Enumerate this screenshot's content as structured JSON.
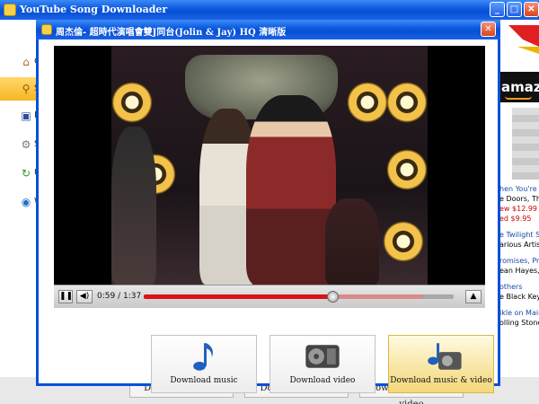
{
  "main_window": {
    "title": "YouTube Song Downloader",
    "sidebar_items": [
      {
        "icon": "home-icon",
        "label": "C"
      },
      {
        "icon": "search-icon",
        "label": "S"
      },
      {
        "icon": "disk-icon",
        "label": "D"
      },
      {
        "icon": "gear-icon",
        "label": "S"
      },
      {
        "icon": "refresh-icon",
        "label": "U"
      },
      {
        "icon": "globe-icon",
        "label": "W"
      }
    ],
    "bottom_buttons": [
      "Download music",
      "Download video",
      "Download music & video"
    ]
  },
  "right_panel": {
    "logo": "amazon",
    "lines": [
      "hen You're S",
      "e Doors, Th",
      "ew $12.99",
      "ed $9.95",
      "e Twilight S",
      "arious Artists",
      "romises, Pro",
      "ean Hayes, N",
      "others",
      "e Black Key",
      "ikle on Main",
      "olling Stone"
    ]
  },
  "dialog": {
    "title": "周杰倫- 超時代演唱會雙J同台(Jolin & Jay) HQ 清晰版",
    "player": {
      "time": "0:59 / 1:37",
      "progress": 0.61,
      "buffered": 0.9
    },
    "buttons": [
      {
        "label": "Download music",
        "icon": "music-note-icon",
        "selected": false
      },
      {
        "label": "Download video",
        "icon": "film-reel-icon",
        "selected": false
      },
      {
        "label": "Download music & video",
        "icon": "music-video-icon",
        "selected": true
      }
    ]
  },
  "colors": {
    "titlebar": "#0a55de",
    "accent": "#f5b623",
    "progress": "#d81414"
  }
}
